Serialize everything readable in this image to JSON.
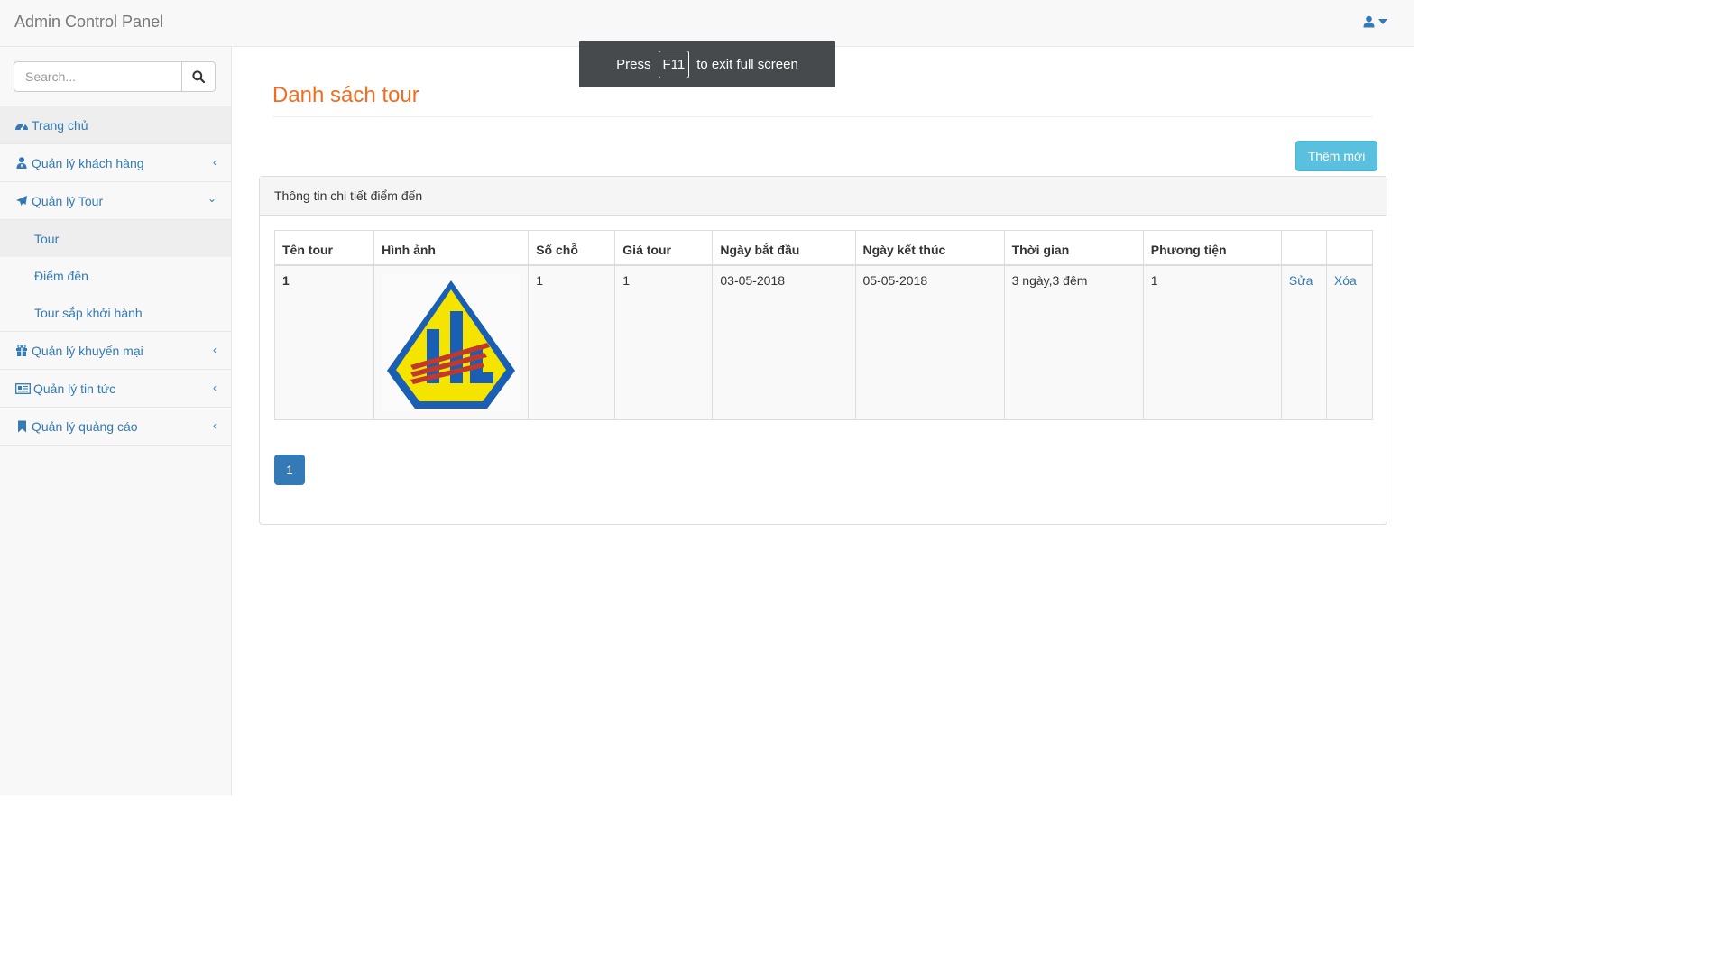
{
  "app": {
    "title": "Admin Control Panel"
  },
  "search": {
    "placeholder": "Search..."
  },
  "sidebar": {
    "items": [
      {
        "label": "Trang chủ"
      },
      {
        "label": "Quản lý khách hàng"
      },
      {
        "label": "Quản lý Tour"
      },
      {
        "label": "Quản lý khuyến mại"
      },
      {
        "label": "Quản lý tin tức"
      },
      {
        "label": "Quản lý quảng cáo"
      }
    ],
    "tour_sub": [
      {
        "label": "Tour"
      },
      {
        "label": "Điểm đến"
      },
      {
        "label": "Tour sắp khởi hành"
      }
    ]
  },
  "fullscreen_toast": {
    "press": "Press",
    "key": "F11",
    "rest": "to exit full screen"
  },
  "page": {
    "title": "Danh sách tour",
    "add_button": "Thêm mới"
  },
  "panel": {
    "heading": "Thông tin chi tiết điểm đến"
  },
  "table": {
    "headers": [
      "Tên tour",
      "Hình ảnh",
      "Số chỗ",
      "Giá tour",
      "Ngày bắt đầu",
      "Ngày kết thúc",
      "Thời gian",
      "Phương tiện",
      "",
      ""
    ],
    "rows": [
      {
        "name": "1",
        "seats": "1",
        "price": "1",
        "start": "03-05-2018",
        "end": "05-05-2018",
        "duration": "3 ngày,3 đêm",
        "transport": "1",
        "edit": "Sửa",
        "delete": "Xóa"
      }
    ]
  },
  "pagination": {
    "current": "1"
  },
  "colors": {
    "title": "#f26c22",
    "link": "#337ab7",
    "info_button": "#5bc0de",
    "primary": "#337ab7"
  }
}
